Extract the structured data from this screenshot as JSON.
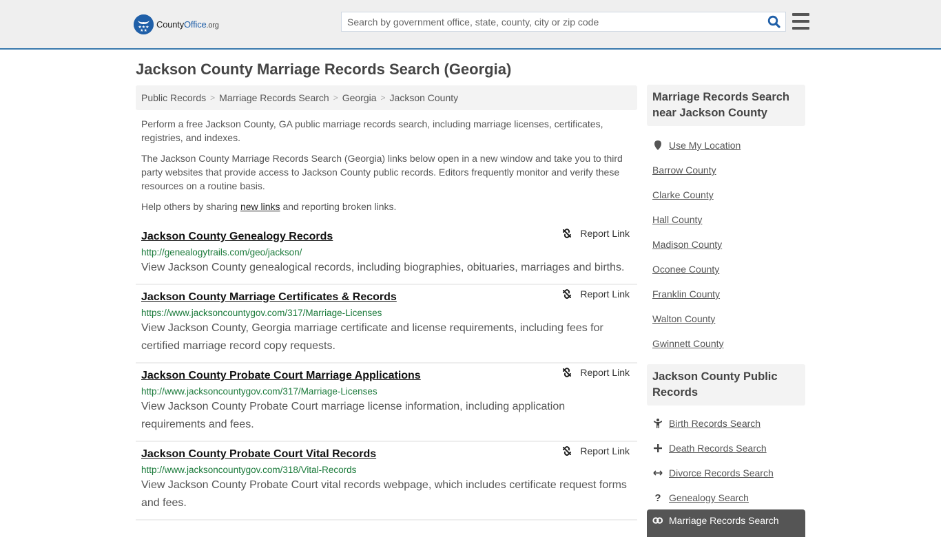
{
  "header": {
    "logo": {
      "name_part1": "County",
      "name_part2": "Office",
      "tld": ".org"
    },
    "search": {
      "placeholder": "Search by government office, state, county, city or zip code",
      "value": ""
    }
  },
  "page_title": "Jackson County Marriage Records Search (Georgia)",
  "breadcrumb": [
    "Public Records",
    "Marriage Records Search",
    "Georgia",
    "Jackson County"
  ],
  "intro": {
    "p1": "Perform a free Jackson County, GA public marriage records search, including marriage licenses, certificates, registries, and indexes.",
    "p2": "The Jackson County Marriage Records Search (Georgia) links below open in a new window and take you to third party websites that provide access to Jackson County public records. Editors frequently monitor and verify these resources on a routine basis.",
    "p3_before": "Help others by sharing ",
    "p3_link": "new links",
    "p3_after": " and reporting broken links."
  },
  "results": [
    {
      "title": "Jackson County Genealogy Records",
      "url": "http://genealogytrails.com/geo/jackson/",
      "description": "View Jackson County genealogical records, including biographies, obituaries, marriages and births.",
      "report_label": "Report Link"
    },
    {
      "title": "Jackson County Marriage Certificates & Records",
      "url": "https://www.jacksoncountygov.com/317/Marriage-Licenses",
      "description": "View Jackson County, Georgia marriage certificate and license requirements, including fees for certified marriage record copy requests.",
      "report_label": "Report Link"
    },
    {
      "title": "Jackson County Probate Court Marriage Applications",
      "url": "http://www.jacksoncountygov.com/317/Marriage-Licenses",
      "description": "View Jackson County Probate Court marriage license information, including application requirements and fees.",
      "report_label": "Report Link"
    },
    {
      "title": "Jackson County Probate Court Vital Records",
      "url": "http://www.jacksoncountygov.com/318/Vital-Records",
      "description": "View Jackson County Probate Court vital records webpage, which includes certificate request forms and fees.",
      "report_label": "Report Link"
    }
  ],
  "sidebar": {
    "nearby": {
      "heading": "Marriage Records Search near Jackson County",
      "use_location": "Use My Location",
      "counties": [
        "Barrow County",
        "Clarke County",
        "Hall County",
        "Madison County",
        "Oconee County",
        "Franklin County",
        "Walton County",
        "Gwinnett County"
      ]
    },
    "public_records": {
      "heading": "Jackson County Public Records",
      "items": [
        {
          "label": "Birth Records Search",
          "icon": "child-icon"
        },
        {
          "label": "Death Records Search",
          "icon": "cross-icon"
        },
        {
          "label": "Divorce Records Search",
          "icon": "arrows-horizontal-icon"
        },
        {
          "label": "Genealogy Search",
          "icon": "question-icon"
        }
      ],
      "active": {
        "label": "Marriage Records Search",
        "icon": "rings-icon"
      }
    }
  },
  "colors": {
    "brand_blue": "#1f5fa8",
    "header_border": "#3a7aad",
    "url_green": "#1a7a3a",
    "active_bg": "#555555"
  }
}
